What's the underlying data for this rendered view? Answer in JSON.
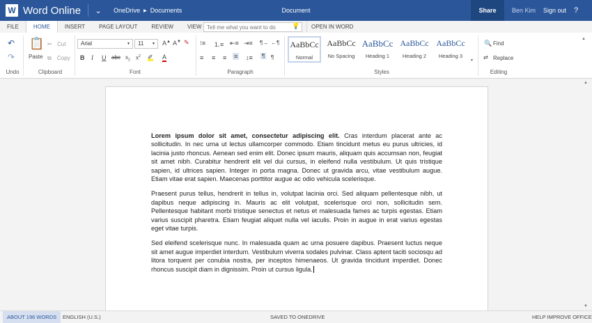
{
  "titlebar": {
    "app_name": "Word Online",
    "breadcrumb": [
      "OneDrive",
      "Documents"
    ],
    "document_title": "Document",
    "share": "Share",
    "user": "Ben Kim",
    "sign_out": "Sign out",
    "help": "?"
  },
  "tabs": [
    {
      "label": "FILE"
    },
    {
      "label": "HOME",
      "active": true
    },
    {
      "label": "INSERT"
    },
    {
      "label": "PAGE LAYOUT"
    },
    {
      "label": "REVIEW"
    },
    {
      "label": "VIEW"
    }
  ],
  "tell_me_placeholder": "Tell me what you want to do",
  "open_in_word": "OPEN IN WORD",
  "ribbon": {
    "groups": {
      "undo": "Undo",
      "clipboard": "Clipboard",
      "font": "Font",
      "paragraph": "Paragraph",
      "styles": "Styles",
      "editing": "Editing"
    },
    "paste": "Paste",
    "cut": "Cut",
    "copy": "Copy",
    "font_name": "Arial",
    "font_size": "11",
    "find": "Find",
    "replace": "Replace",
    "styles": [
      {
        "sample": "AaBbCc",
        "name": "Normal"
      },
      {
        "sample": "AaBbCc",
        "name": "No Spacing"
      },
      {
        "sample": "AaBbCc",
        "name": "Heading 1"
      },
      {
        "sample": "AaBbCc",
        "name": "Heading 2"
      },
      {
        "sample": "AaBbCc",
        "name": "Heading 3"
      }
    ]
  },
  "document": {
    "paragraphs": [
      "Lorem ipsum dolor sit amet, consectetur adipiscing elit. Cras interdum placerat ante ac sollicitudin. In nec urna ut lectus ullamcorper commodo. Etiam tincidunt metus eu purus ultricies, id lacinia justo rhoncus. Aenean sed enim elit. Donec ipsum mauris, aliquam quis accumsan non, feugiat sit amet nibh. Curabitur hendrerit elit vel dui cursus, in eleifend nulla vestibulum. Ut quis tristique sapien, id ultrices sapien. Integer in porta magna. Donec ut gravida arcu, vitae vestibulum augue. Etiam vitae erat sapien. Maecenas porttitor augue ac odio vehicula scelerisque.",
      "Praesent purus tellus, hendrerit in tellus in, volutpat lacinia orci. Sed aliquam pellentesque nibh, ut dapibus neque adipiscing in. Mauris ac elit volutpat, scelerisque orci non, sollicitudin sem. Pellentesque habitant morbi tristique senectus et netus et malesuada fames ac turpis egestas. Etiam varius suscipit pharetra. Etiam feugiat aliquet nulla vel iaculis. Proin in augue in erat varius egestas eget vitae turpis.",
      "Sed eleifend scelerisque nunc. In malesuada quam ac urna posuere dapibus. Praesent luctus neque sit amet augue imperdiet interdum. Vestibulum viverra sodales pulvinar. Class aptent taciti sociosqu ad litora torquent per conubia nostra, per inceptos himenaeos. Ut gravida tincidunt imperdiet. Donec rhoncus suscipit diam in dignissim. Proin ut cursus ligula."
    ],
    "bold_lead": "Lorem ipsum dolor sit amet, consectetur adipiscing elit."
  },
  "statusbar": {
    "words": "ABOUT 196 WORDS",
    "language": "ENGLISH (U.S.)",
    "saved": "SAVED TO ONEDRIVE",
    "help_improve": "HELP IMPROVE OFFICE"
  },
  "colors": {
    "accent": "#2b579a",
    "share_bg": "#1e4780",
    "spell_error": "#dd2233"
  }
}
